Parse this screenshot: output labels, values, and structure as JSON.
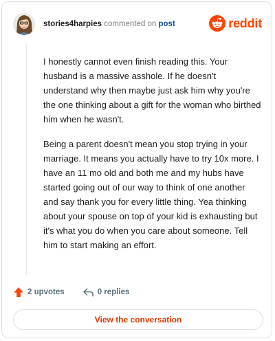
{
  "header": {
    "username": "stories4harpies",
    "commented_on": "commented on",
    "post_link": "post",
    "brand_word": "reddit",
    "brand_icon": "reddit-alien-icon",
    "avatar_icon": "user-avatar-icon"
  },
  "comment": {
    "paragraphs": [
      "I honestly cannot even finish reading this. Your husband is a massive asshole. If he doesn't understand why then maybe just ask him why you're the one thinking about a gift for the woman who birthed him when he wasn't.",
      "Being a parent doesn't mean you stop trying in your marriage. It means you actually have to try 10x more. I have an 11 mo old and both me and my hubs have started going out of our way to think of one another and say thank you for every little thing. Yea thinking about your spouse on top of your kid is exhausting but it's what you do when you care about someone. Tell him to start making an effort."
    ]
  },
  "actions": {
    "upvotes": "2 upvotes",
    "replies": "0 replies",
    "upvote_icon": "upvote-arrow-icon",
    "reply_icon": "reply-arrow-icon"
  },
  "cta": {
    "label": "View the conversation"
  },
  "colors": {
    "brand": "#ff4500",
    "link": "#0a4ea6",
    "cta_text": "#d93a00",
    "muted": "#576f76"
  }
}
